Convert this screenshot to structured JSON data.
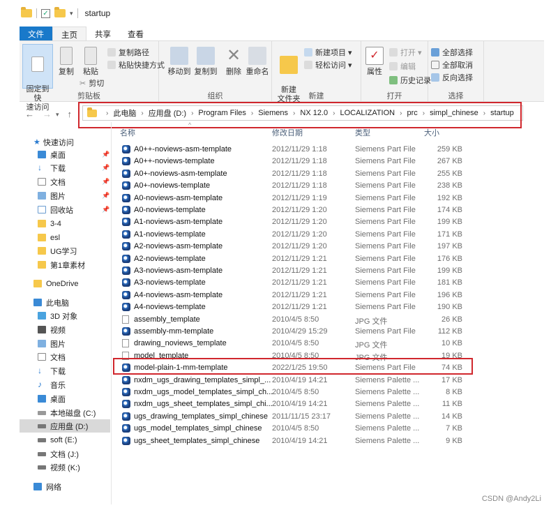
{
  "window": {
    "title": "startup"
  },
  "ribbon_tabs": [
    "文件",
    "主页",
    "共享",
    "查看"
  ],
  "ribbon": {
    "clipboard": {
      "pin": "固定到快\n速访问",
      "copy": "复制",
      "paste": "粘贴",
      "copy_path": "复制路径",
      "paste_shortcut": "粘贴快捷方式",
      "cut": "剪切",
      "label": "剪贴板"
    },
    "organize": {
      "move_to": "移动到",
      "copy_to": "复制到",
      "delete": "删除",
      "rename": "重命名",
      "label": "组织"
    },
    "new": {
      "new_folder": "新建\n文件夹",
      "new_item": "新建项目 ▾",
      "easy_access": "轻松访问 ▾",
      "label": "新建"
    },
    "open": {
      "properties": "属性",
      "open": "打开 ▾",
      "edit": "编辑",
      "history": "历史记录",
      "label": "打开"
    },
    "select": {
      "select_all": "全部选择",
      "select_none": "全部取消",
      "invert": "反向选择",
      "label": "选择"
    }
  },
  "address": {
    "crumbs": [
      "此电脑",
      "应用盘 (D:)",
      "Program Files",
      "Siemens",
      "NX 12.0",
      "LOCALIZATION",
      "prc",
      "simpl_chinese",
      "startup"
    ]
  },
  "nav": {
    "quick_access": "快速访问",
    "items": [
      "桌面",
      "下载",
      "文档",
      "图片",
      "回收站",
      "3-4",
      "esl",
      "UG学习",
      "第1章素材",
      "OneDrive",
      "此电脑",
      "3D 对象",
      "视频",
      "图片",
      "文档",
      "下载",
      "音乐",
      "桌面",
      "本地磁盘 (C:)",
      "应用盘 (D:)",
      "soft (E:)",
      "文档 (J:)",
      "视频 (K:)",
      "网络"
    ]
  },
  "columns": {
    "name": "名称",
    "date": "修改日期",
    "type": "类型",
    "size": "大小"
  },
  "files": [
    {
      "name": "A0++-noviews-asm-template",
      "date": "2012/11/29 1:18",
      "type": "Siemens Part File",
      "size": "259 KB",
      "icon": "nx-part-icon"
    },
    {
      "name": "A0++-noviews-template",
      "date": "2012/11/29 1:18",
      "type": "Siemens Part File",
      "size": "267 KB",
      "icon": "nx-part-icon"
    },
    {
      "name": "A0+-noviews-asm-template",
      "date": "2012/11/29 1:18",
      "type": "Siemens Part File",
      "size": "255 KB",
      "icon": "nx-part-icon"
    },
    {
      "name": "A0+-noviews-template",
      "date": "2012/11/29 1:18",
      "type": "Siemens Part File",
      "size": "238 KB",
      "icon": "nx-part-icon"
    },
    {
      "name": "A0-noviews-asm-template",
      "date": "2012/11/29 1:19",
      "type": "Siemens Part File",
      "size": "192 KB",
      "icon": "nx-part-icon"
    },
    {
      "name": "A0-noviews-template",
      "date": "2012/11/29 1:20",
      "type": "Siemens Part File",
      "size": "174 KB",
      "icon": "nx-part-icon"
    },
    {
      "name": "A1-noviews-asm-template",
      "date": "2012/11/29 1:20",
      "type": "Siemens Part File",
      "size": "199 KB",
      "icon": "nx-part-icon"
    },
    {
      "name": "A1-noviews-template",
      "date": "2012/11/29 1:20",
      "type": "Siemens Part File",
      "size": "171 KB",
      "icon": "nx-part-icon"
    },
    {
      "name": "A2-noviews-asm-template",
      "date": "2012/11/29 1:20",
      "type": "Siemens Part File",
      "size": "197 KB",
      "icon": "nx-part-icon"
    },
    {
      "name": "A2-noviews-template",
      "date": "2012/11/29 1:21",
      "type": "Siemens Part File",
      "size": "176 KB",
      "icon": "nx-part-icon"
    },
    {
      "name": "A3-noviews-asm-template",
      "date": "2012/11/29 1:21",
      "type": "Siemens Part File",
      "size": "199 KB",
      "icon": "nx-part-icon"
    },
    {
      "name": "A3-noviews-template",
      "date": "2012/11/29 1:21",
      "type": "Siemens Part File",
      "size": "181 KB",
      "icon": "nx-part-icon"
    },
    {
      "name": "A4-noviews-asm-template",
      "date": "2012/11/29 1:21",
      "type": "Siemens Part File",
      "size": "196 KB",
      "icon": "nx-part-icon"
    },
    {
      "name": "A4-noviews-template",
      "date": "2012/11/29 1:21",
      "type": "Siemens Part File",
      "size": "190 KB",
      "icon": "nx-part-icon"
    },
    {
      "name": "assembly_template",
      "date": "2010/4/5 8:50",
      "type": "JPG 文件",
      "size": "26 KB",
      "icon": "jpg-file-icon"
    },
    {
      "name": "assembly-mm-template",
      "date": "2010/4/29 15:29",
      "type": "Siemens Part File",
      "size": "112 KB",
      "icon": "nx-part-icon"
    },
    {
      "name": "drawing_noviews_template",
      "date": "2010/4/5 8:50",
      "type": "JPG 文件",
      "size": "10 KB",
      "icon": "jpg-file-icon"
    },
    {
      "name": "model_template",
      "date": "2010/4/5 8:50",
      "type": "JPG 文件",
      "size": "19 KB",
      "icon": "jpg-file-icon"
    },
    {
      "name": "model-plain-1-mm-template",
      "date": "2022/1/25 19:50",
      "type": "Siemens Part File",
      "size": "74 KB",
      "icon": "nx-part-icon"
    },
    {
      "name": "nxdm_ugs_drawing_templates_simpl_...",
      "date": "2010/4/19 14:21",
      "type": "Siemens Palette ...",
      "size": "17 KB",
      "icon": "nx-part-icon"
    },
    {
      "name": "nxdm_ugs_model_templates_simpl_ch...",
      "date": "2010/4/5 8:50",
      "type": "Siemens Palette ...",
      "size": "8 KB",
      "icon": "nx-part-icon"
    },
    {
      "name": "nxdm_ugs_sheet_templates_simpl_chi...",
      "date": "2010/4/19 14:21",
      "type": "Siemens Palette ...",
      "size": "11 KB",
      "icon": "nx-part-icon"
    },
    {
      "name": "ugs_drawing_templates_simpl_chinese",
      "date": "2011/11/15 23:17",
      "type": "Siemens Palette ...",
      "size": "14 KB",
      "icon": "nx-part-icon"
    },
    {
      "name": "ugs_model_templates_simpl_chinese",
      "date": "2010/4/5 8:50",
      "type": "Siemens Palette ...",
      "size": "7 KB",
      "icon": "nx-part-icon"
    },
    {
      "name": "ugs_sheet_templates_simpl_chinese",
      "date": "2010/4/19 14:21",
      "type": "Siemens Palette ...",
      "size": "9 KB",
      "icon": "nx-part-icon"
    }
  ],
  "watermark": "CSDN @Andy2Li",
  "colors": {
    "accent": "#1979ca",
    "highlight_box": "#d0272d"
  }
}
